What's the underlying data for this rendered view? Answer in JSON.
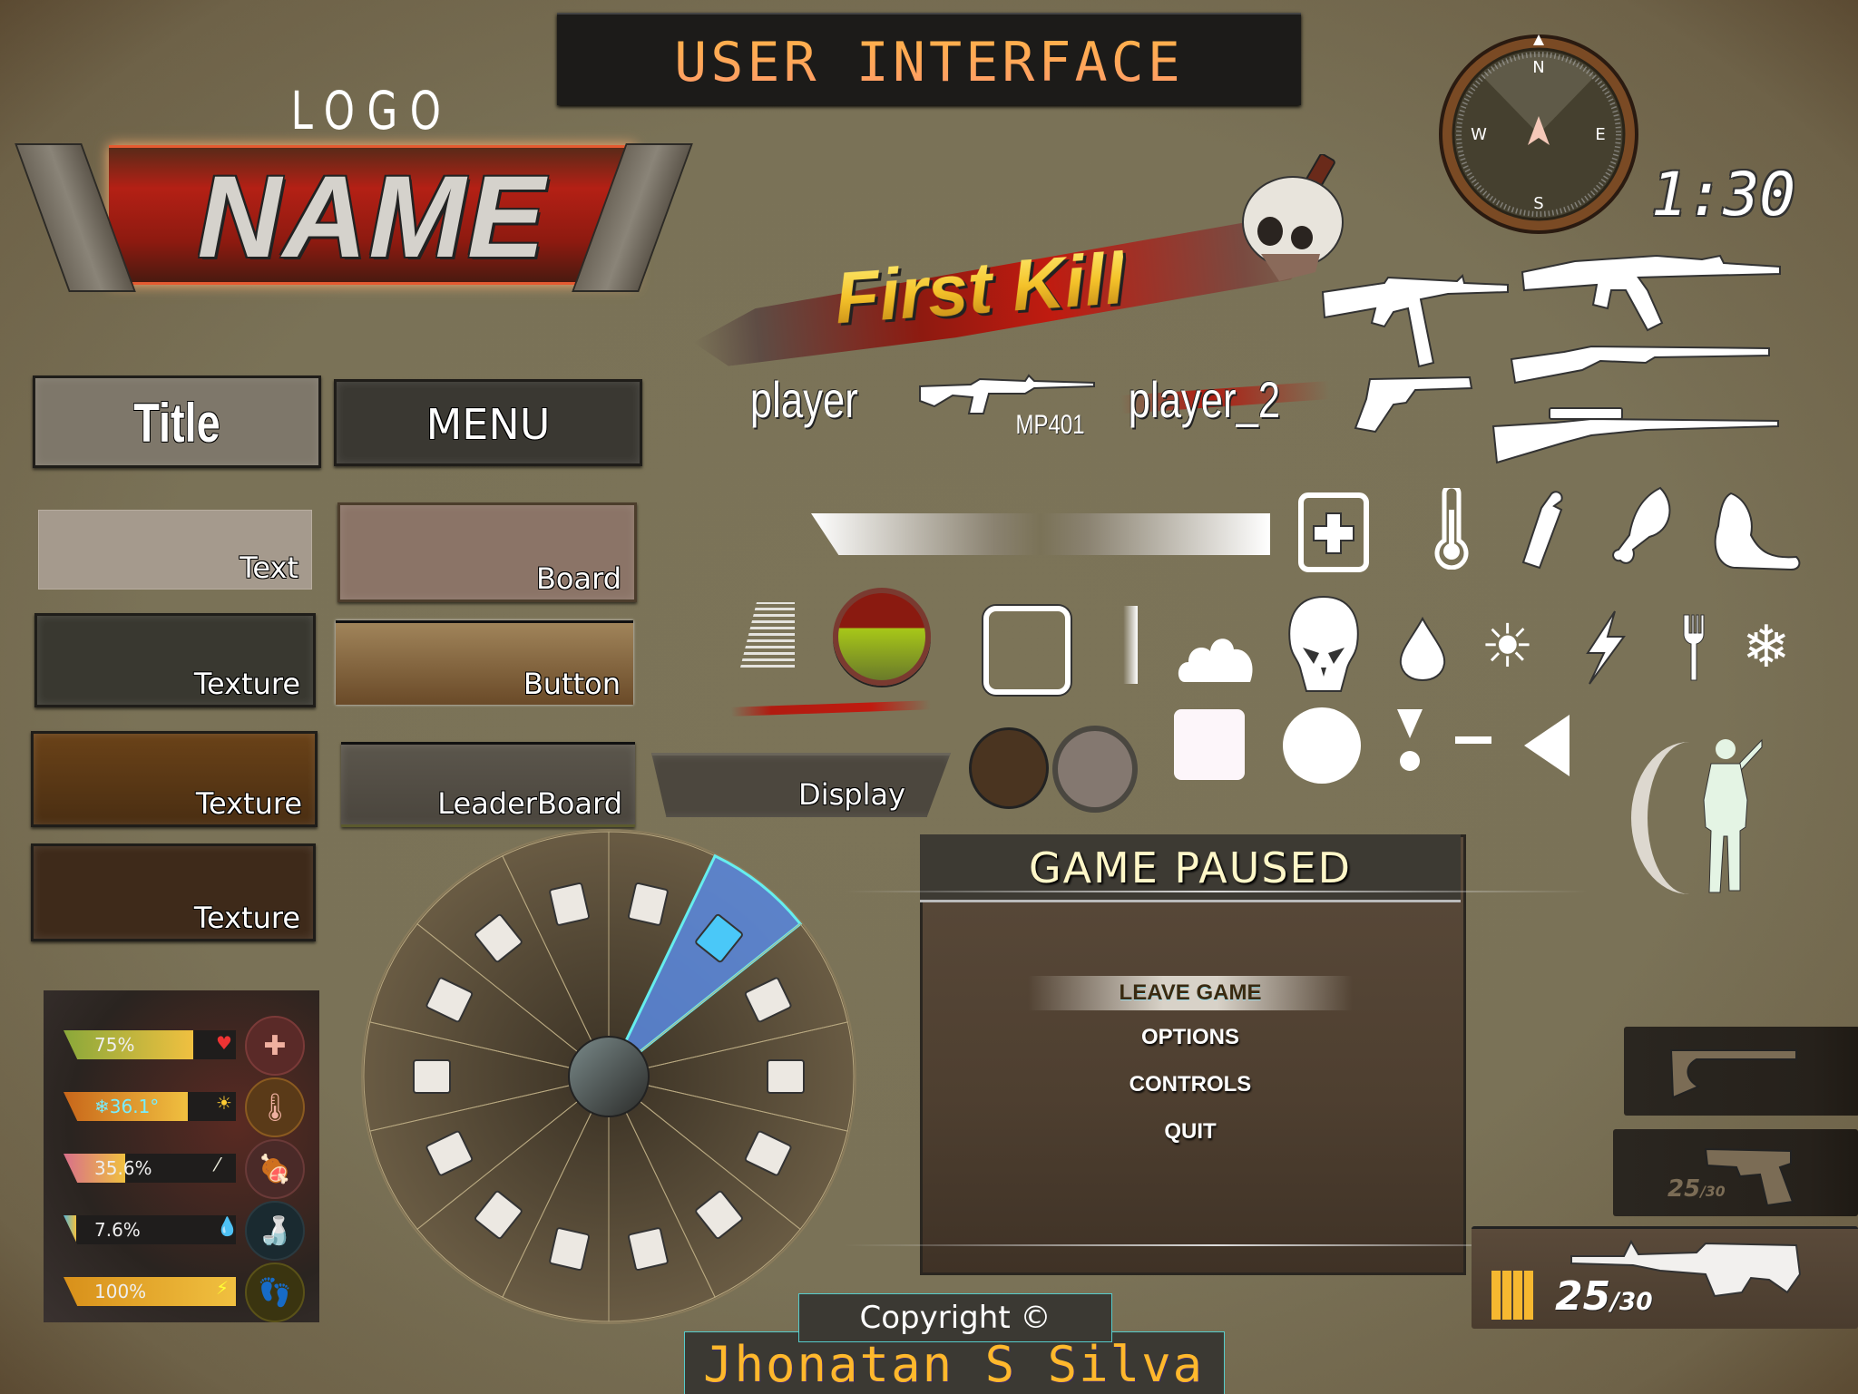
{
  "header": {
    "title": "USER INTERFACE"
  },
  "logo": {
    "caption": "LOGO",
    "name": "NAME"
  },
  "buttons": {
    "title": "Title",
    "menu": "MENU"
  },
  "panels": [
    {
      "id": "text",
      "label": "Text"
    },
    {
      "id": "board",
      "label": "Board"
    },
    {
      "id": "texture_dark",
      "label": "Texture"
    },
    {
      "id": "button",
      "label": "Button"
    },
    {
      "id": "texture_brown",
      "label": "Texture"
    },
    {
      "id": "leaderboard",
      "label": "LeaderBoard"
    },
    {
      "id": "texture_darkbrown",
      "label": "Texture"
    },
    {
      "id": "display",
      "label": "Display"
    }
  ],
  "kill_feed": {
    "banner": "First Kill",
    "killer": "player",
    "victim": "player_2",
    "weapon": "MP401",
    "weapon_icon": "assault-rifle-icon"
  },
  "compass": {
    "north": "N",
    "south": "S",
    "east": "E",
    "west": "W"
  },
  "timer": "1:30",
  "weapon_icons": [
    "smg-icon",
    "ak-rifle-icon",
    "revolver-icon",
    "shotgun-icon",
    "sniper-rifle-icon"
  ],
  "icons_row1": [
    "gradient-bar",
    "medkit-icon",
    "thermometer-icon",
    "water-bottle-icon",
    "meat-leg-icon",
    "foot-icon"
  ],
  "icons_row2": [
    "brush-stroke",
    "health-orb",
    "frame-icon",
    "slider-bar",
    "cloud-icon",
    "skull-icon",
    "drop-icon",
    "sun-icon",
    "lightning-icon",
    "fork-icon",
    "snowflake-icon"
  ],
  "icons_row3": [
    "dark-circle-button",
    "grey-circle-button",
    "square-shape",
    "circle-shape",
    "exclamation-shape",
    "dash-shape",
    "triangle-left-shape"
  ],
  "stance": {
    "icon": "soldier-silhouette-icon"
  },
  "build_wheel": {
    "selected_index": 1,
    "items": [
      "wall",
      "window-wall",
      "foundation-block",
      "floor-tile",
      "wide-doorway",
      "doorway",
      "corner-block",
      "triangle-floor",
      "ramp",
      "l-stairs",
      "straight-stairs",
      "pillar",
      "half-wall",
      "door-frame"
    ]
  },
  "pause_menu": {
    "title": "GAME PAUSED",
    "items": [
      "LEAVE GAME",
      "OPTIONS",
      "CONTROLS",
      "QUIT"
    ],
    "selected": "LEAVE GAME"
  },
  "stats": [
    {
      "name": "health",
      "value": "75%",
      "fill": 0.75,
      "color": "#8aa83a",
      "mini_icon": "heart-icon",
      "icon": "medkit-icon"
    },
    {
      "name": "temperature",
      "value": "❄36.1°",
      "fill": 0.72,
      "color": "#c8661a",
      "mini_icon": "sun-icon",
      "icon": "thermometer-icon"
    },
    {
      "name": "hunger",
      "value": "35.6%",
      "fill": 0.356,
      "color": "#d8708a",
      "mini_icon": "drumstick-icon",
      "icon": "meat-leg-icon"
    },
    {
      "name": "thirst",
      "value": "7.6%",
      "fill": 0.076,
      "color": "#5ab8d8",
      "mini_icon": "drop-icon",
      "icon": "water-bottle-icon"
    },
    {
      "name": "stamina",
      "value": "100%",
      "fill": 1.0,
      "color": "#d8901a",
      "mini_icon": "lightning-icon",
      "icon": "foot-icon"
    }
  ],
  "weapon_slots": [
    {
      "name": "axe",
      "ammo": "",
      "max": ""
    },
    {
      "name": "pistol",
      "ammo": "25",
      "max": "/30"
    },
    {
      "name": "rifle",
      "ammo": "25",
      "max": "/30"
    }
  ],
  "footer": {
    "copyright": "Copyright ©",
    "author": "Jhonatan S Silva"
  },
  "colors": {
    "accent_orange": "#ffb347",
    "selection_blue": "#5a8ae0",
    "background": "#7a7257"
  }
}
